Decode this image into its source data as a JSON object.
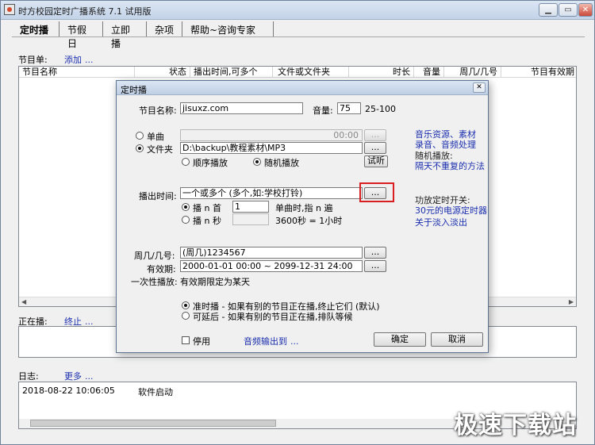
{
  "window": {
    "title": "时方校园定时广播系统 7.1 试用版"
  },
  "tabs": [
    "定时播",
    "节假日",
    "立即播",
    "杂项",
    "帮助~咨询专家"
  ],
  "program_list": {
    "label": "节目单:",
    "add_link": "添加",
    "columns": [
      "节目名称",
      "状态",
      "播出时间,可多个",
      "文件或文件夹",
      "时长",
      "音量",
      "周几/几号",
      "节目有效期"
    ]
  },
  "playing": {
    "label": "正在播:",
    "stop_link": "终止"
  },
  "log": {
    "label": "日志:",
    "more_link": "更多",
    "rows": [
      {
        "time": "2018-08-22 10:06:05",
        "message": "软件启动"
      }
    ]
  },
  "dialog": {
    "title": "定时播",
    "name_label": "节目名称:",
    "name_value": "jisuxz.com",
    "volume_label": "音量:",
    "volume_value": "75",
    "volume_range": "25-100",
    "single_label": "单曲",
    "single_time": "00:00",
    "folder_label": "文件夹",
    "folder_path": "D:\\backup\\教程素材\\MP3",
    "order_label": "顺序播放",
    "random_label": "随机播放",
    "listen_button": "试听",
    "play_time_label": "播出时间:",
    "play_time_value": "一个或多个 (多个,如:学校打铃)",
    "play_n_label": "播 n 首",
    "play_n_value": "1",
    "play_n_note": "单曲时,指 n 遍",
    "play_sec_label": "播 n 秒",
    "play_sec_note": "3600秒 = 1小时",
    "weekday_label": "周几/几号:",
    "weekday_value": "(周几)1234567",
    "valid_label": "有效期:",
    "valid_value": "2000-01-01 00:00 ~ 2099-12-31 24:00",
    "once_label": "一次性播放:",
    "once_value": "有效期限定为某天",
    "mode_exact": "准时播 - 如果有别的节目正在播,终止它们 (默认)",
    "mode_delay": "可延后 - 如果有别的节目正在播,排队等候",
    "disable_label": "停用",
    "audio_output_link": "音频输出到",
    "ok_button": "确定",
    "cancel_button": "取消",
    "ellipsis": "...",
    "side": {
      "music_link": "音乐资源、素材",
      "record_link": "录音、音频处理",
      "random_text": "随机播放:",
      "random_link": "隔天不重复的方法",
      "power_text": "功放定时开关:",
      "power_link": "30元的电源定时器",
      "fade_link": "关于淡入淡出"
    }
  },
  "more_dots": "...",
  "watermark": "极速下载站"
}
